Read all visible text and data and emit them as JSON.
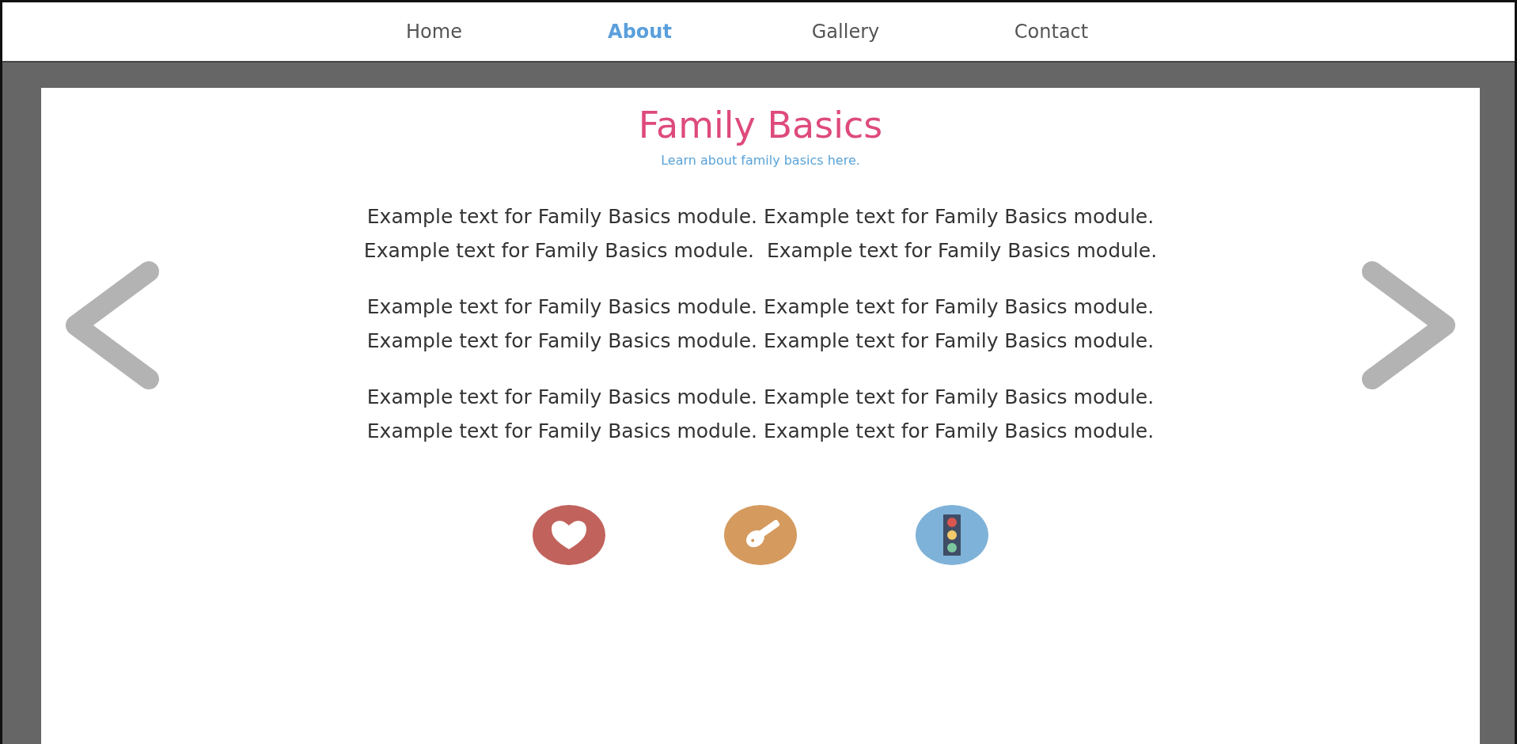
{
  "nav": [
    {
      "label": "Home",
      "selected": false
    },
    {
      "label": "About",
      "selected": true
    },
    {
      "label": "Gallery",
      "selected": false
    },
    {
      "label": "Contact",
      "selected": false
    }
  ],
  "module": {
    "title": "Family Basics",
    "subtitle": "Learn about family basics here.",
    "paragraphs": [
      "Example text for Family Basics module. Example text for Family Basics module. Example text for Family Basics module.  Example text for Family Basics module.",
      "Example text for Family Basics module. Example text for Family Basics module. Example text for Family Basics module. Example text for Family Basics module.",
      "Example text for Family Basics module. Example text for Family Basics module. Example text for Family Basics module. Example text for Family Basics module."
    ],
    "icons": [
      {
        "kind": "heart"
      },
      {
        "kind": "key"
      },
      {
        "kind": "traffic"
      }
    ]
  }
}
